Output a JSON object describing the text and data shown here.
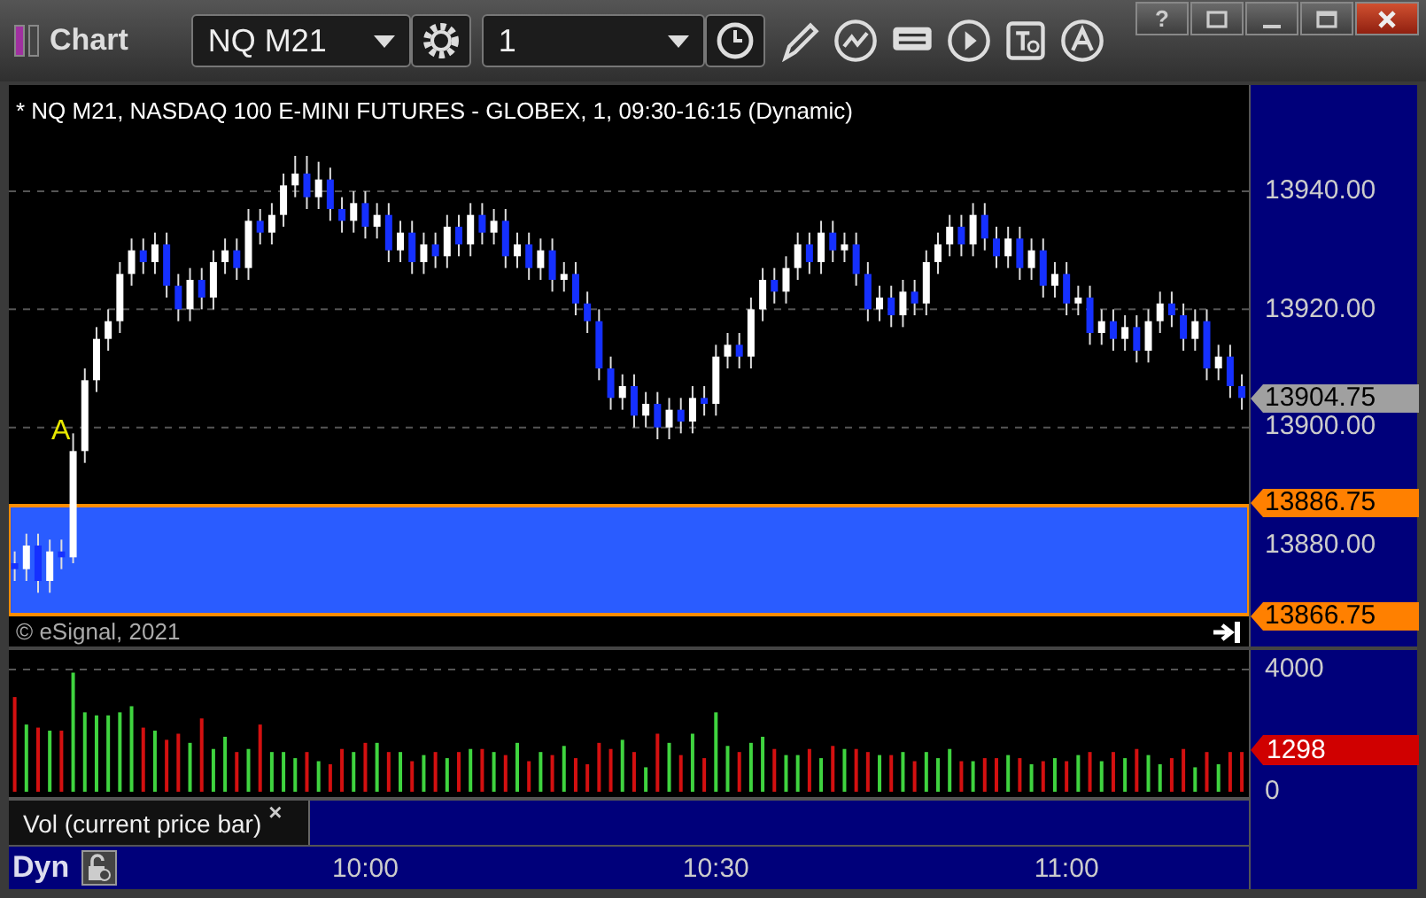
{
  "window": {
    "title": "Chart",
    "help_button": "?"
  },
  "toolbar": {
    "symbol": "NQ M21",
    "interval": "1"
  },
  "price_pane": {
    "header": "* NQ M21, NASDAQ 100 E-MINI FUTURES - GLOBEX, 1, 09:30-16:15 (Dynamic)",
    "chart_data": {
      "type": "candlestick",
      "x": [
        570,
        571,
        572,
        573,
        574,
        575,
        576,
        577,
        578,
        579,
        580,
        581,
        582,
        583,
        584,
        585,
        586,
        587,
        588,
        589,
        590,
        591,
        592,
        593,
        594,
        595,
        596,
        597,
        598,
        599,
        600,
        601,
        602,
        603,
        604,
        605,
        606,
        607,
        608,
        609,
        610,
        611,
        612,
        613,
        614,
        615,
        616,
        617,
        618,
        619,
        620,
        621,
        622,
        623,
        624,
        625,
        626,
        627,
        628,
        629,
        630,
        631,
        632,
        633,
        634,
        635,
        636,
        637,
        638,
        639,
        640,
        641,
        642,
        643,
        644,
        645,
        646,
        647,
        648,
        649,
        650,
        651,
        652,
        653,
        654,
        655,
        656,
        657,
        658,
        659,
        660,
        661,
        662,
        663,
        664,
        665,
        666,
        667,
        668,
        669,
        670,
        671,
        672,
        673,
        674,
        675
      ],
      "ohlc": [
        [
          13877,
          13879,
          13874,
          13876
        ],
        [
          13876,
          13882,
          13874,
          13880
        ],
        [
          13880,
          13882,
          13872,
          13874
        ],
        [
          13874,
          13881,
          13872,
          13879
        ],
        [
          13879,
          13881,
          13876,
          13878
        ],
        [
          13878,
          13899,
          13877,
          13896
        ],
        [
          13896,
          13910,
          13894,
          13908
        ],
        [
          13908,
          13917,
          13906,
          13915
        ],
        [
          13915,
          13920,
          13913,
          13918
        ],
        [
          13918,
          13928,
          13916,
          13926
        ],
        [
          13926,
          13932,
          13924,
          13930
        ],
        [
          13930,
          13932,
          13926,
          13928
        ],
        [
          13928,
          13933,
          13926,
          13931
        ],
        [
          13931,
          13933,
          13922,
          13924
        ],
        [
          13924,
          13926,
          13918,
          13920
        ],
        [
          13920,
          13927,
          13918,
          13925
        ],
        [
          13925,
          13927,
          13920,
          13922
        ],
        [
          13922,
          13930,
          13920,
          13928
        ],
        [
          13928,
          13932,
          13926,
          13930
        ],
        [
          13930,
          13932,
          13925,
          13927
        ],
        [
          13927,
          13937,
          13925,
          13935
        ],
        [
          13935,
          13937,
          13931,
          13933
        ],
        [
          13933,
          13938,
          13931,
          13936
        ],
        [
          13936,
          13943,
          13934,
          13941
        ],
        [
          13941,
          13946,
          13939,
          13943
        ],
        [
          13943,
          13946,
          13937,
          13939
        ],
        [
          13939,
          13945,
          13937,
          13942
        ],
        [
          13942,
          13944,
          13935,
          13937
        ],
        [
          13937,
          13939,
          13933,
          13935
        ],
        [
          13935,
          13940,
          13933,
          13938
        ],
        [
          13938,
          13940,
          13932,
          13934
        ],
        [
          13934,
          13938,
          13932,
          13936
        ],
        [
          13936,
          13938,
          13928,
          13930
        ],
        [
          13930,
          13935,
          13928,
          13933
        ],
        [
          13933,
          13935,
          13926,
          13928
        ],
        [
          13928,
          13933,
          13926,
          13931
        ],
        [
          13931,
          13933,
          13927,
          13929
        ],
        [
          13929,
          13936,
          13927,
          13934
        ],
        [
          13934,
          13936,
          13929,
          13931
        ],
        [
          13931,
          13938,
          13929,
          13936
        ],
        [
          13936,
          13938,
          13931,
          13933
        ],
        [
          13933,
          13937,
          13931,
          13935
        ],
        [
          13935,
          13937,
          13927,
          13929
        ],
        [
          13929,
          13933,
          13927,
          13931
        ],
        [
          13931,
          13933,
          13925,
          13927
        ],
        [
          13927,
          13932,
          13925,
          13930
        ],
        [
          13930,
          13932,
          13923,
          13925
        ],
        [
          13925,
          13928,
          13923,
          13926
        ],
        [
          13926,
          13928,
          13919,
          13921
        ],
        [
          13921,
          13923,
          13916,
          13918
        ],
        [
          13918,
          13920,
          13908,
          13910
        ],
        [
          13910,
          13912,
          13903,
          13905
        ],
        [
          13905,
          13909,
          13903,
          13907
        ],
        [
          13907,
          13909,
          13900,
          13902
        ],
        [
          13902,
          13906,
          13900,
          13904
        ],
        [
          13904,
          13906,
          13898,
          13900
        ],
        [
          13900,
          13905,
          13898,
          13903
        ],
        [
          13903,
          13905,
          13899,
          13901
        ],
        [
          13901,
          13907,
          13899,
          13905
        ],
        [
          13905,
          13907,
          13902,
          13904
        ],
        [
          13904,
          13914,
          13902,
          13912
        ],
        [
          13912,
          13916,
          13910,
          13914
        ],
        [
          13914,
          13916,
          13910,
          13912
        ],
        [
          13912,
          13922,
          13910,
          13920
        ],
        [
          13920,
          13927,
          13918,
          13925
        ],
        [
          13925,
          13927,
          13921,
          13923
        ],
        [
          13923,
          13929,
          13921,
          13927
        ],
        [
          13927,
          13933,
          13925,
          13931
        ],
        [
          13931,
          13933,
          13926,
          13928
        ],
        [
          13928,
          13935,
          13926,
          13933
        ],
        [
          13933,
          13935,
          13928,
          13930
        ],
        [
          13930,
          13933,
          13928,
          13931
        ],
        [
          13931,
          13933,
          13924,
          13926
        ],
        [
          13926,
          13928,
          13918,
          13920
        ],
        [
          13920,
          13924,
          13918,
          13922
        ],
        [
          13922,
          13924,
          13917,
          13919
        ],
        [
          13919,
          13925,
          13917,
          13923
        ],
        [
          13923,
          13925,
          13919,
          13921
        ],
        [
          13921,
          13930,
          13919,
          13928
        ],
        [
          13928,
          13933,
          13926,
          13931
        ],
        [
          13931,
          13936,
          13929,
          13934
        ],
        [
          13934,
          13936,
          13929,
          13931
        ],
        [
          13931,
          13938,
          13929,
          13936
        ],
        [
          13936,
          13938,
          13930,
          13932
        ],
        [
          13932,
          13934,
          13927,
          13929
        ],
        [
          13929,
          13934,
          13927,
          13932
        ],
        [
          13932,
          13934,
          13925,
          13927
        ],
        [
          13927,
          13932,
          13925,
          13930
        ],
        [
          13930,
          13932,
          13922,
          13924
        ],
        [
          13924,
          13928,
          13922,
          13926
        ],
        [
          13926,
          13928,
          13919,
          13921
        ],
        [
          13921,
          13924,
          13919,
          13922
        ],
        [
          13922,
          13924,
          13914,
          13916
        ],
        [
          13916,
          13920,
          13914,
          13918
        ],
        [
          13918,
          13920,
          13913,
          13915
        ],
        [
          13915,
          13919,
          13913,
          13917
        ],
        [
          13917,
          13919,
          13911,
          13913
        ],
        [
          13913,
          13920,
          13911,
          13918
        ],
        [
          13918,
          13923,
          13916,
          13921
        ],
        [
          13921,
          13923,
          13917,
          13919
        ],
        [
          13919,
          13921,
          13913,
          13915
        ],
        [
          13915,
          13920,
          13913,
          13918
        ],
        [
          13918,
          13920,
          13908,
          13910
        ],
        [
          13910,
          13914,
          13908,
          13912
        ],
        [
          13912,
          13914,
          13905,
          13907
        ],
        [
          13907,
          13909,
          13903,
          13905
        ]
      ],
      "xlim": [
        569.5,
        675.6
      ],
      "ylim": [
        13868,
        13958
      ],
      "grid": true,
      "yticks": [
        {
          "value": 13940,
          "label": "13940.00"
        },
        {
          "value": 13920,
          "label": "13920.00"
        },
        {
          "value": 13900,
          "label": "13900.00"
        },
        {
          "value": 13880,
          "label": "13880.00"
        }
      ],
      "bands": [
        {
          "axis": "y",
          "from": 13866.75,
          "to": 13886.75,
          "color": "#2a5cff"
        }
      ]
    },
    "price_tags": [
      {
        "text": "13904.75",
        "kind": "last"
      },
      {
        "text": "13886.75",
        "kind": "band-top"
      },
      {
        "text": "13866.75",
        "kind": "band-bottom"
      }
    ],
    "marker": "A",
    "copyright": "© eSignal, 2021"
  },
  "volume_pane": {
    "chart_data": {
      "type": "bar",
      "x": [
        570,
        571,
        572,
        573,
        574,
        575,
        576,
        577,
        578,
        579,
        580,
        581,
        582,
        583,
        584,
        585,
        586,
        587,
        588,
        589,
        590,
        591,
        592,
        593,
        594,
        595,
        596,
        597,
        598,
        599,
        600,
        601,
        602,
        603,
        604,
        605,
        606,
        607,
        608,
        609,
        610,
        611,
        612,
        613,
        614,
        615,
        616,
        617,
        618,
        619,
        620,
        621,
        622,
        623,
        624,
        625,
        626,
        627,
        628,
        629,
        630,
        631,
        632,
        633,
        634,
        635,
        636,
        637,
        638,
        639,
        640,
        641,
        642,
        643,
        644,
        645,
        646,
        647,
        648,
        649,
        650,
        651,
        652,
        653,
        654,
        655,
        656,
        657,
        658,
        659,
        660,
        661,
        662,
        663,
        664,
        665,
        666,
        667,
        668,
        669,
        670,
        671,
        672,
        673,
        674,
        675
      ],
      "values": [
        3100,
        2200,
        2100,
        2000,
        2000,
        3900,
        2600,
        2500,
        2500,
        2600,
        2800,
        2100,
        2000,
        1700,
        1900,
        1600,
        2400,
        1400,
        1800,
        1300,
        1400,
        2200,
        1300,
        1300,
        1100,
        1300,
        1000,
        900,
        1400,
        1300,
        1600,
        1600,
        1300,
        1300,
        1000,
        1200,
        1300,
        1100,
        1300,
        1400,
        1400,
        1300,
        1200,
        1600,
        1000,
        1300,
        1200,
        1500,
        1100,
        900,
        1600,
        1400,
        1700,
        1300,
        800,
        1900,
        1600,
        1200,
        1900,
        1100,
        2600,
        1500,
        1300,
        1600,
        1800,
        1400,
        1200,
        1200,
        1400,
        1100,
        1500,
        1400,
        1400,
        1300,
        1200,
        1200,
        1300,
        1000,
        1300,
        1100,
        1400,
        1000,
        1000,
        1100,
        1100,
        1200,
        1100,
        900,
        1000,
        1100,
        1000,
        1200,
        1300,
        1000,
        1300,
        1100,
        1400,
        1200,
        900,
        1100,
        1400,
        800,
        1300,
        900,
        1300,
        1300
      ],
      "xlim": [
        569.5,
        675.6
      ],
      "ylim": [
        0,
        4640
      ],
      "grid": true,
      "xticks": [
        {
          "value": 600,
          "label": "10:00"
        },
        {
          "value": 630,
          "label": "10:30"
        },
        {
          "value": 660,
          "label": "11:00"
        }
      ],
      "yticks": [
        {
          "value": 4000,
          "label": "4000"
        },
        {
          "value": 0,
          "label": "0"
        }
      ]
    },
    "volume_tag": "1298",
    "legend": "Vol (current price bar)",
    "legend_close": "×"
  },
  "status": {
    "mode": "Dyn"
  }
}
